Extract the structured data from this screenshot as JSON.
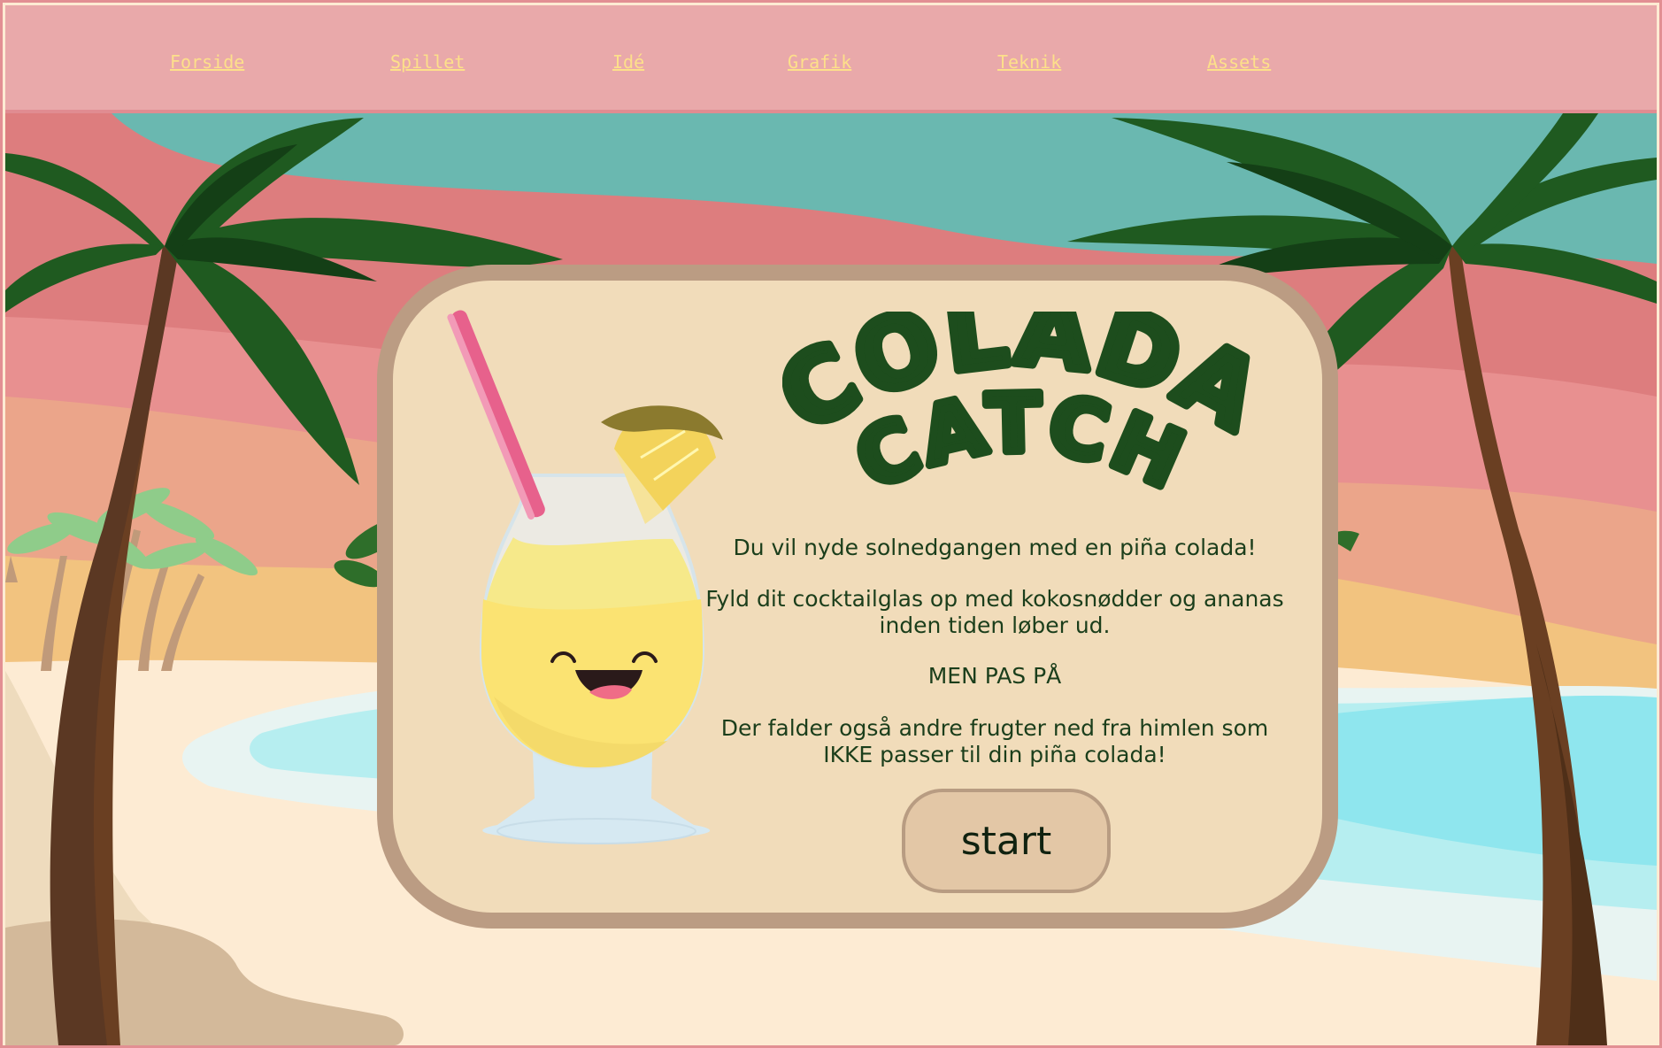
{
  "nav": {
    "items": [
      {
        "label": "Forside"
      },
      {
        "label": "Spillet"
      },
      {
        "label": "Idé"
      },
      {
        "label": "Grafik"
      },
      {
        "label": "Teknik"
      },
      {
        "label": "Assets"
      }
    ]
  },
  "game": {
    "title_line1": "COLADA",
    "title_line2": "CATCH",
    "intro": "Du vil nyde solnedgangen med en piña colada!",
    "instructions": "Fyld dit cocktailglas op med kokosnødder og ananas inden tiden løber ud.",
    "warning": "MEN PAS PÅ",
    "warning_detail": "Der falder også andre frugter ned fra himlen som IKKE passer til din piña colada!",
    "start_label": "start"
  },
  "icons": {
    "drink": "pina-colada-glass-icon",
    "palm": "palm-tree-icon"
  },
  "colors": {
    "nav_bg": "#e9a9aa",
    "nav_link": "#fde08a",
    "card_bg": "#f1dcba",
    "card_border": "#bb9c83",
    "title": "#1d4d1d",
    "text": "#1b3e1b"
  }
}
